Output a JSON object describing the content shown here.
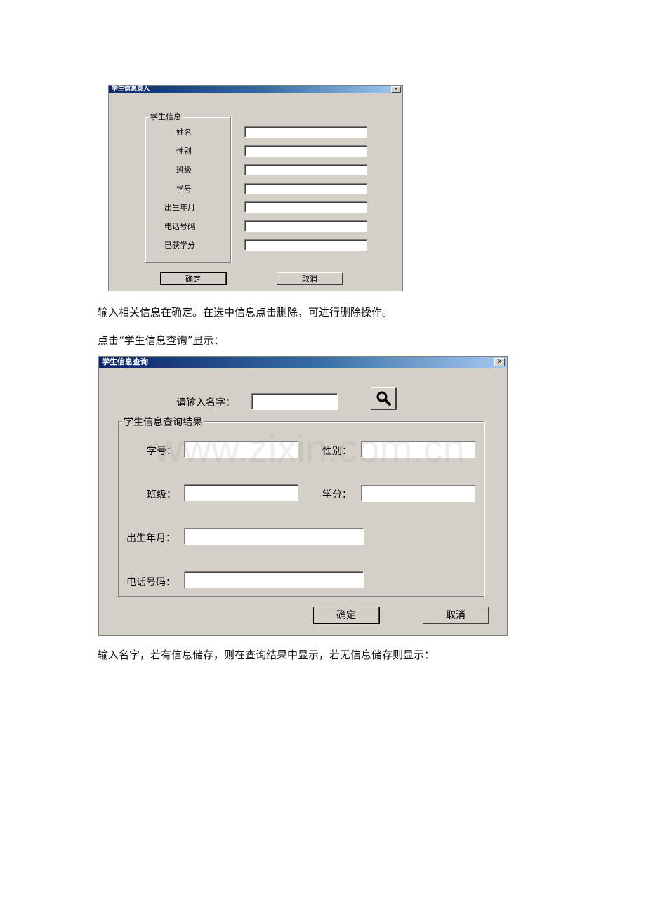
{
  "dialog1": {
    "title": "学生信息录入",
    "close_glyph": "✕",
    "group_label": "学生信息",
    "fields": [
      {
        "label": "姓名",
        "value": ""
      },
      {
        "label": "性别",
        "value": ""
      },
      {
        "label": "班级",
        "value": ""
      },
      {
        "label": "学号",
        "value": ""
      },
      {
        "label": "出生年月",
        "value": ""
      },
      {
        "label": "电话号码",
        "value": ""
      },
      {
        "label": "已获学分",
        "value": ""
      }
    ],
    "ok_label": "确定",
    "cancel_label": "取消"
  },
  "paragraphs": {
    "p1": "输入相关信息在确定。在选中信息点击删除，可进行删除操作。",
    "p2": "点击“学生信息查询”显示：",
    "p3": "输入名字，若有信息储存，则在查询结果中显示，若无信息储存则显示："
  },
  "dialog2": {
    "title": "学生信息查询",
    "close_glyph": "✕",
    "search_label": "请输入名字：",
    "search_value": "",
    "search_icon": "magnifier-icon",
    "group_label": "学生信息查询结果",
    "student_id_label": "学号：",
    "gender_label": "性别：",
    "class_label": "班级：",
    "credit_label": "学分：",
    "birth_label": "出生年月：",
    "phone_label": "电话号码：",
    "ok_label": "确定",
    "cancel_label": "取消"
  },
  "watermark": "www.zixin.com.cn",
  "colors": {
    "dialog_bg": "#d4d0c8",
    "title_start": "#0a246a",
    "title_end": "#a6caf0"
  }
}
